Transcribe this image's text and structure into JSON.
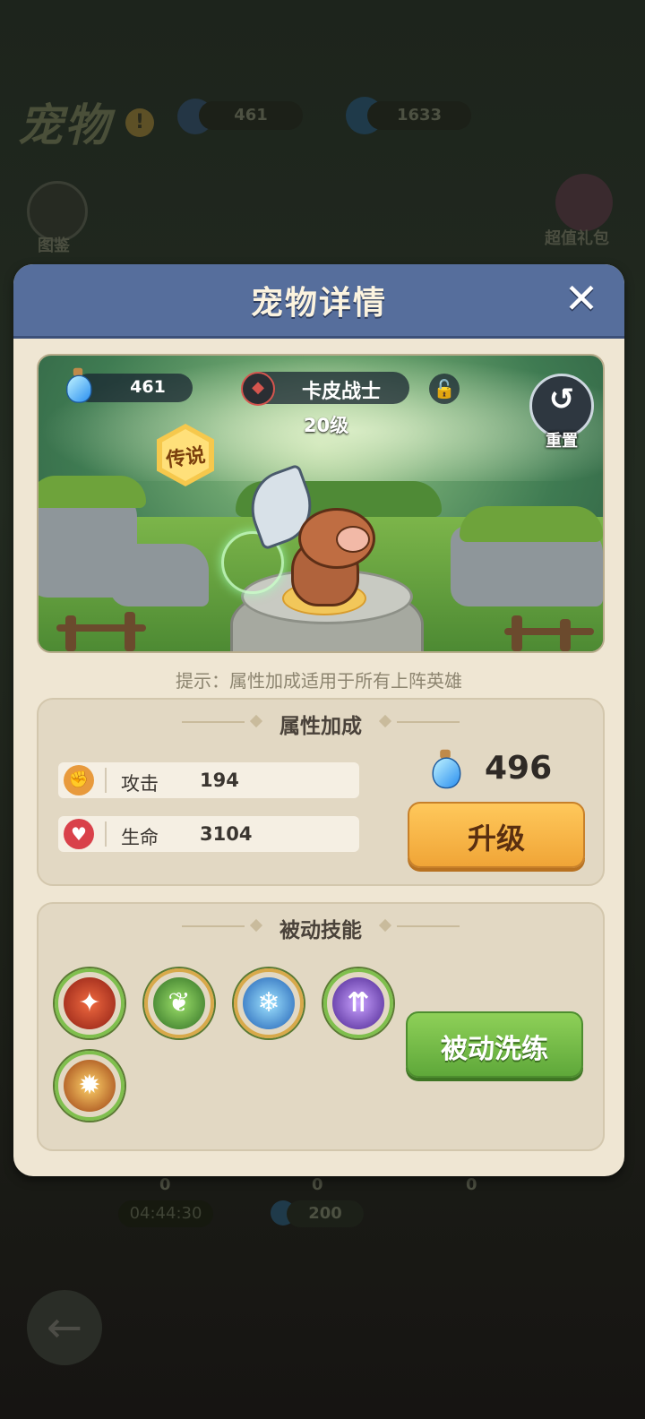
{
  "background": {
    "page_title": "宠物",
    "info_symbol": "!",
    "potion_count": "461",
    "gem_count": "1633",
    "codex_label": "图鉴",
    "gift_label": "超值礼包",
    "timer": "04:44:30",
    "bottom_counts": [
      "0",
      "0",
      "0"
    ],
    "bottom_cost": "200",
    "back_symbol": "←"
  },
  "modal": {
    "title": "宠物详情",
    "close_symbol": "✕"
  },
  "scene": {
    "potion_count": "461",
    "pet_name": "卡皮战士",
    "level": "20级",
    "rarity_badge": "传说",
    "reset_label": "重置",
    "reset_symbol": "↺",
    "lock_symbol": "🔓"
  },
  "hint": "提示：属性加成适用于所有上阵英雄",
  "attributes": {
    "title": "属性加成",
    "stats": [
      {
        "label": "攻击",
        "value": "194",
        "icon": "attack-icon",
        "icon_color": "#e89a3c"
      },
      {
        "label": "生命",
        "value": "3104",
        "icon": "heart-icon",
        "icon_color": "#d9414a"
      }
    ],
    "upgrade_cost": "496",
    "upgrade_label": "升级"
  },
  "passive_skills": {
    "title": "被动技能",
    "skills": [
      {
        "name": "fire-claw-skill-icon",
        "color": "#c43a2b",
        "glyph": "✦"
      },
      {
        "name": "leaf-skill-icon",
        "color": "#4e9a38",
        "glyph": "❦"
      },
      {
        "name": "ice-skill-icon",
        "color": "#3b8fd9",
        "glyph": "❄"
      },
      {
        "name": "arcane-skill-icon",
        "color": "#7a4bd0",
        "glyph": "⇈"
      },
      {
        "name": "flame-burst-skill-icon",
        "color": "#d98a22",
        "glyph": "✹"
      }
    ],
    "refine_label": "被动洗练"
  },
  "colors": {
    "modal_header": "#566e9c",
    "modal_body": "#efe6d3",
    "upgrade_button": "#f5b444",
    "refine_button": "#78bf4a"
  }
}
